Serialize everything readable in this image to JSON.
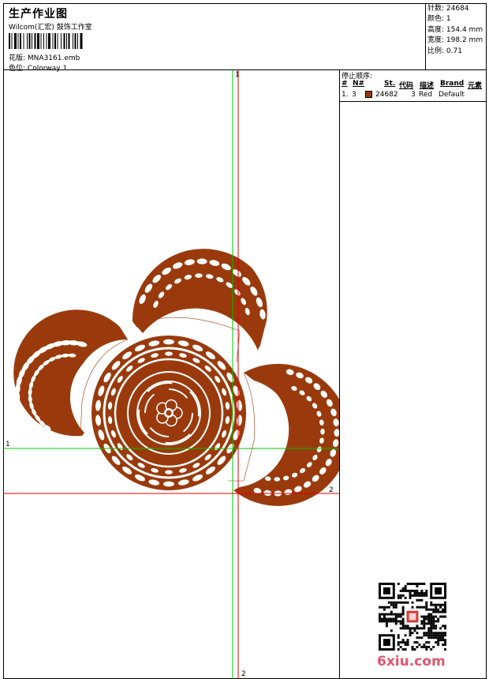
{
  "header": {
    "title": "生产作业图",
    "company": "Wilcom(汇宏) 鼓饰工作室",
    "design_label": "花版:",
    "design_file": "MNA3161.emb",
    "colorway_label": "色位:",
    "colorway": "Colorway 1"
  },
  "stats": [
    {
      "label": "针数:",
      "value": "24684"
    },
    {
      "label": "颜色:",
      "value": "1"
    },
    {
      "label": "高度:",
      "value": "154.4 mm"
    },
    {
      "label": "宽度:",
      "value": "198.2 mm"
    },
    {
      "label": "比例:",
      "value": "0.71"
    }
  ],
  "stop_sequence": {
    "title": "停止顺序:",
    "columns": {
      "hash": "#",
      "no": "N#",
      "st": "St.",
      "code": "代码",
      "desc": "描述",
      "brand": "Brand",
      "element": "元素"
    },
    "rows": [
      {
        "index": "1.",
        "no": "3",
        "st": "24682",
        "code": "3",
        "desc": "Red",
        "brand": "Default",
        "color": "#9a3a0c"
      }
    ]
  },
  "guides": {
    "v1": "1",
    "h1": "1",
    "v2": "2",
    "h2": "2",
    "green": "#00c000",
    "red": "#e00000"
  },
  "design": {
    "thread_color": "#9a3a0c"
  },
  "watermark": {
    "text": "6xiu.com"
  }
}
